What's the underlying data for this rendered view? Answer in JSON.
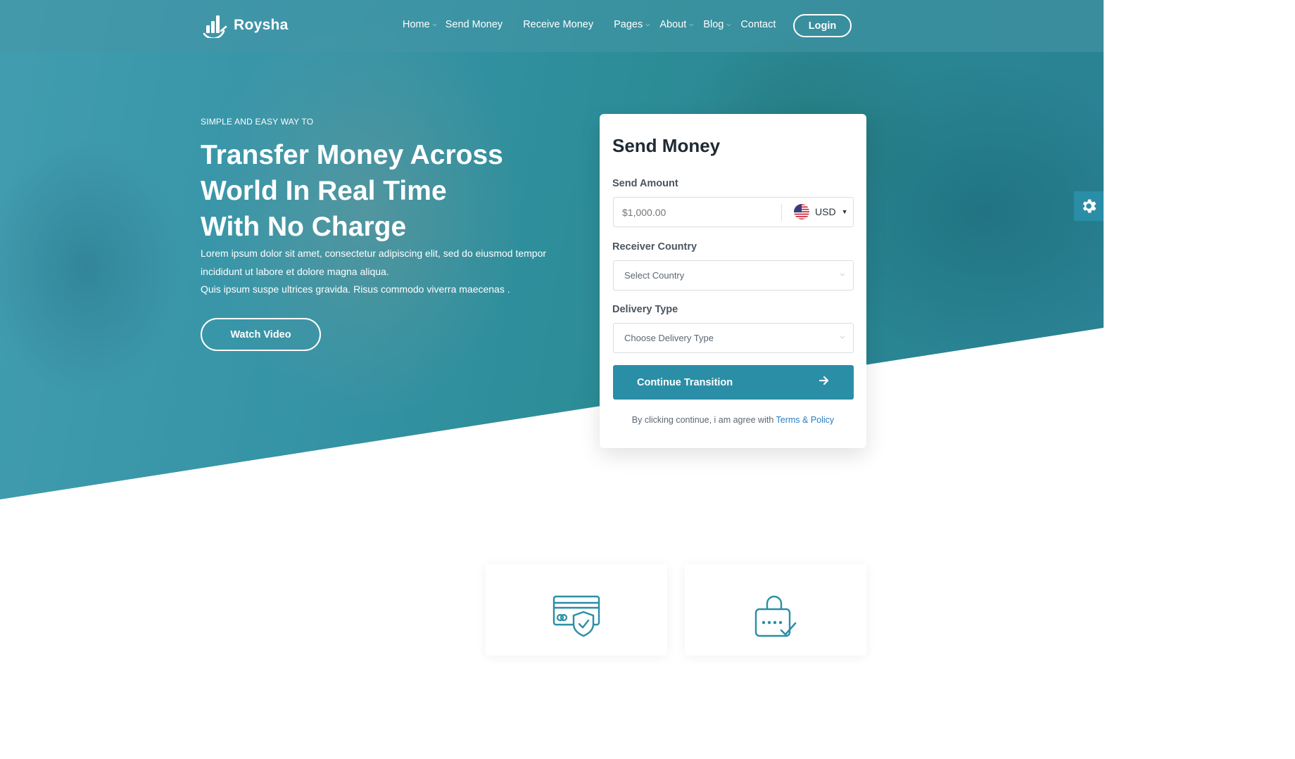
{
  "header": {
    "brand": "Roysha",
    "nav": [
      {
        "label": "Home",
        "dropdown": true
      },
      {
        "label": "Send Money",
        "dropdown": false
      },
      {
        "label": "Receive Money",
        "dropdown": false
      },
      {
        "label": "Pages",
        "dropdown": true
      },
      {
        "label": "About",
        "dropdown": true
      },
      {
        "label": "Blog",
        "dropdown": true
      },
      {
        "label": "Contact",
        "dropdown": false
      }
    ],
    "login_label": "Login"
  },
  "hero": {
    "eyebrow": "SIMPLE AND EASY WAY TO",
    "headline_lines": [
      "Transfer Money Across",
      "World In Real Time",
      "With No Charge"
    ],
    "lead_lines": [
      "Lorem ipsum dolor sit amet, consectetur adipiscing elit, sed do eiusmod tempor",
      "incididunt ut labore et dolore magna aliqua.",
      "Quis ipsum suspe ultrices gravida. Risus commodo viverra maecenas ."
    ],
    "watch_label": "Watch Video"
  },
  "send_form": {
    "title": "Send Money",
    "amount_label": "Send Amount",
    "amount_placeholder": "$1,000.00",
    "currency": "USD",
    "country_label": "Receiver Country",
    "country_value": "Select Country",
    "delivery_label": "Delivery Type",
    "delivery_value": "Choose Delivery Type",
    "continue_label": "Continue Transition",
    "terms_prefix": "By clicking continue, i am agree with",
    "terms_link": "Terms & Policy"
  },
  "colors": {
    "accent": "#2a8ea6",
    "link": "#2a7cc1",
    "hero_overlay": "#2793a8"
  },
  "icons": {
    "settings": "gear-icon",
    "feature_1": "card-shield-icon",
    "feature_2": "lock-check-icon"
  }
}
